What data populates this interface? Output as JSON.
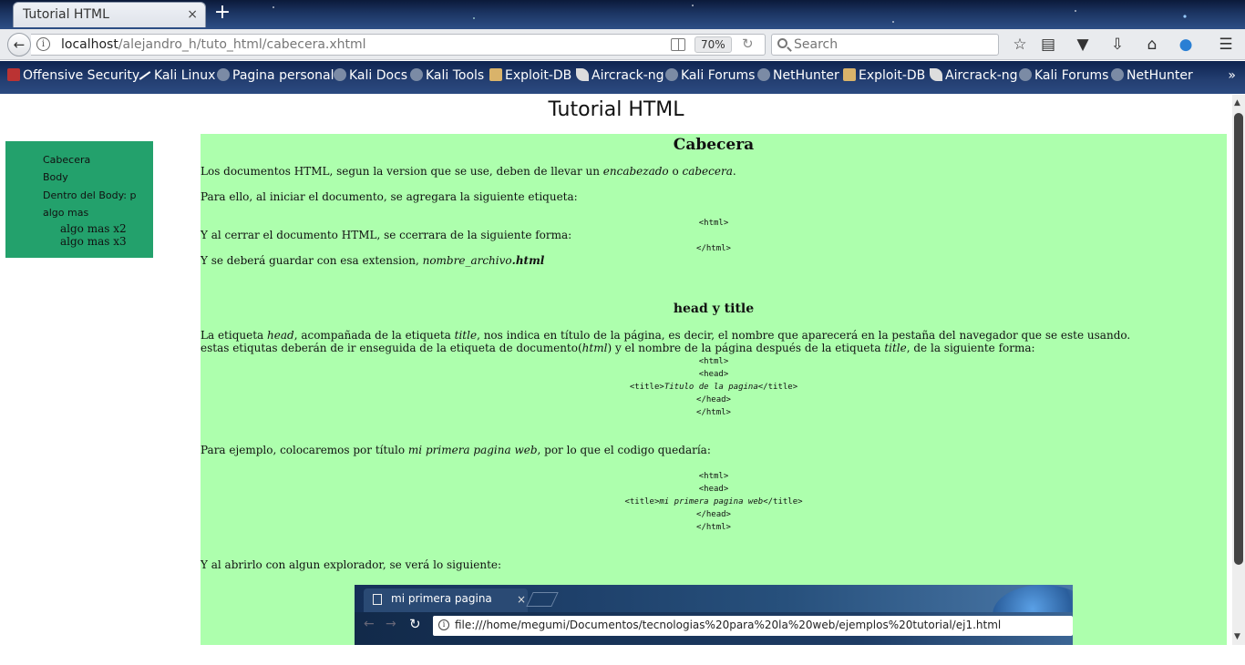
{
  "browser": {
    "tab_title": "Tutorial HTML",
    "tab_close": "×",
    "new_tab": "+",
    "url_host": "localhost",
    "url_path": "/alejandro_h/tuto_html/cabecera.xhtml",
    "zoom": "70%",
    "search_placeholder": "Search",
    "toolbar_icons": [
      "back-icon",
      "info-icon",
      "reader-view-icon",
      "reload-icon",
      "bookmark-star-icon",
      "library-icon",
      "pocket-icon",
      "download-icon",
      "home-icon",
      "menu-icon"
    ]
  },
  "bookmarks": [
    "Offensive Security",
    "Kali Linux",
    "Pagina personal",
    "Kali Docs",
    "Kali Tools",
    "Exploit-DB",
    "Aircrack-ng",
    "Kali Forums",
    "NetHunter",
    "Exploit-DB",
    "Aircrack-ng",
    "Kali Forums",
    "NetHunter"
  ],
  "bookmarks_more": "»",
  "page": {
    "site_title": "Tutorial HTML",
    "sidebar": {
      "items": [
        "Cabecera",
        "Body",
        "Dentro del Body: p",
        "algo mas"
      ],
      "subitems": [
        "algo mas x2",
        "algo mas x3"
      ]
    },
    "section1": {
      "heading": "Cabecera",
      "p1_pre": "Los documentos HTML, segun la version que se use, deben de llevar un ",
      "p1_em1": "encabezado",
      "p1_mid": " o ",
      "p1_em2": "cabecera",
      "p1_end": ".",
      "p2": "Para ello, al iniciar el documento, se agregara la siguiente etiqueta:",
      "code_open": "<html>",
      "p3": "Y al cerrar el documento HTML, se ccerrara de la siguiente forma:",
      "code_close": "</html>",
      "p4_pre": "Y se deberá guardar con esa extension, ",
      "p4_em": "nombre_archivo",
      "p4_strong": ".html"
    },
    "section2": {
      "heading": "head y title",
      "p1_a": "La etiqueta ",
      "p1_em1": "head",
      "p1_b": ", acompañada de la etiqueta ",
      "p1_em2": "title",
      "p1_c": ", nos indica en título de la página, es decir, el nombre que aparecerá en la pestaña del navegador que se este usando.",
      "p2_a": "estas etiqutas deberán de ir enseguida de la etiqueta de documento(",
      "p2_em1": "html",
      "p2_b": ") y el nombre de la página después de la etiqueta ",
      "p2_em2": "title",
      "p2_c": ", de la siguiente forma:",
      "code1": [
        "<html>",
        "<head>",
        "<title>",
        "</title>",
        "</head>",
        "</html>"
      ],
      "code1_title_text": "Titulo de la pagina",
      "p3_a": "Para ejemplo, colocaremos por título ",
      "p3_em": "mi primera pagina web",
      "p3_b": ", por lo que el codigo quedaría:",
      "code2_title_text": "mi primera pagina web",
      "p4": "Y al abrirlo con algun explorador, se verá lo siguiente:"
    },
    "example_browser": {
      "tab_title": "mi primera pagina",
      "tab_close": "×",
      "url": "file:///home/megumi/Documentos/tecnologias%20para%20la%20web/ejemplos%20tutorial/ej1.html"
    }
  }
}
